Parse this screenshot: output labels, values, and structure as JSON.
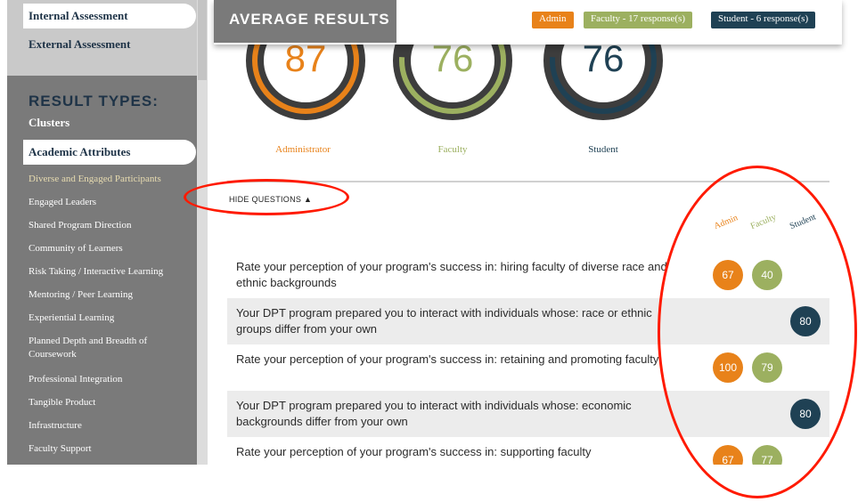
{
  "sidebar": {
    "internal_assessment": "Internal Assessment",
    "external_assessment": "External Assessment",
    "result_types_heading": "RESULT TYPES:",
    "clusters": "Clusters",
    "academic_attributes": "Academic Attributes",
    "items": [
      "Diverse and Engaged Participants",
      "Engaged Leaders",
      "Shared Program Direction",
      "Community of Learners",
      "Risk Taking / Interactive Learning",
      "Mentoring / Peer Learning",
      "Experiential Learning",
      "Planned Depth and Breadth of Coursework",
      "Professional Integration",
      "Tangible Product",
      "Infrastructure",
      "Faculty Support"
    ]
  },
  "header": {
    "title": "AVERAGE RESULTS",
    "legend": {
      "admin": "Admin",
      "faculty": "Faculty - 17 response(s)",
      "student": "Student - 6 response(s)"
    }
  },
  "colors": {
    "admin": "#e8821a",
    "faculty": "#9cb060",
    "student": "#1f4154",
    "ring_track": "#3d3d3d",
    "sidebar": "#7a7a7a",
    "annotation": "#ff1a00"
  },
  "scores": {
    "administrator": {
      "value": "87",
      "label": "Administrator"
    },
    "faculty": {
      "value": "76",
      "label": "Faculty"
    },
    "student": {
      "value": "76",
      "label": "Student"
    }
  },
  "questions_toggle": "HIDE QUESTIONS ▲",
  "columns": {
    "admin": "Admin",
    "faculty": "Faculty",
    "student": "Student"
  },
  "questions": [
    {
      "text": "Rate your perception of your program's success in: hiring faculty of diverse race and ethnic backgrounds",
      "admin": "67",
      "faculty": "40",
      "student": ""
    },
    {
      "text": "Your DPT program prepared you to interact with individuals whose: race or ethnic groups differ from your own",
      "admin": "",
      "faculty": "",
      "student": "80"
    },
    {
      "text": "Rate your perception of your program's success in: retaining and promoting faculty",
      "admin": "100",
      "faculty": "79",
      "student": ""
    },
    {
      "text": "Your DPT program prepared you to interact with individuals whose: economic backgrounds differ from your own",
      "admin": "",
      "faculty": "",
      "student": "80"
    },
    {
      "text": "Rate your perception of your program's success in: supporting faculty",
      "admin": "67",
      "faculty": "77",
      "student": ""
    }
  ]
}
